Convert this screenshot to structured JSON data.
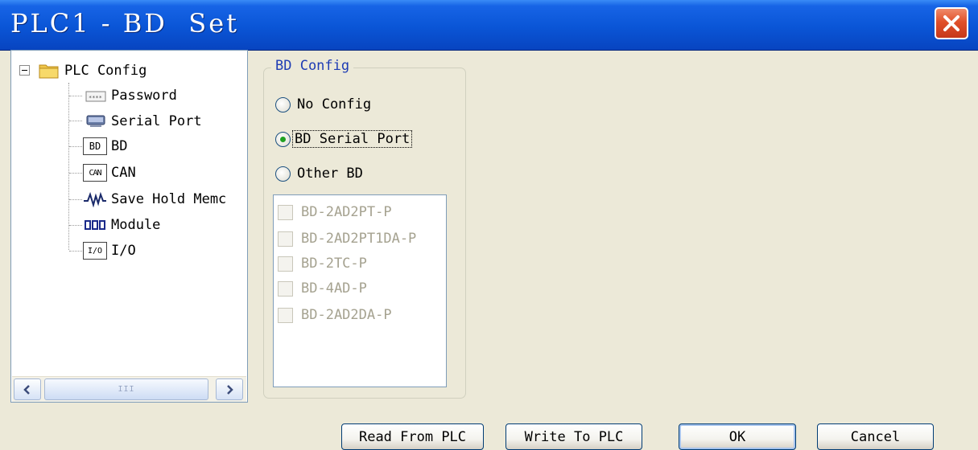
{
  "window": {
    "title": "PLC1 - BD  Set"
  },
  "tree": {
    "root": "PLC Config",
    "items": [
      {
        "label": "Password",
        "icon": "password-icon"
      },
      {
        "label": "Serial Port",
        "icon": "serial-port-icon"
      },
      {
        "label": "BD",
        "icon": "bd-icon",
        "icon_text": "BD",
        "selected": true
      },
      {
        "label": "CAN",
        "icon": "can-icon",
        "icon_text": "CAN"
      },
      {
        "label": "Save Hold Memc",
        "icon": "waveform-icon"
      },
      {
        "label": "Module",
        "icon": "module-icon"
      },
      {
        "label": "I/O",
        "icon": "io-icon",
        "icon_text": "I/O"
      }
    ],
    "scroll_thumb_glyph": "III"
  },
  "bd_config": {
    "legend": "BD Config",
    "options": [
      {
        "label": "No Config",
        "checked": false
      },
      {
        "label": "BD Serial Port",
        "checked": true
      },
      {
        "label": "Other BD",
        "checked": false
      }
    ],
    "modules": [
      {
        "label": "BD-2AD2PT-P",
        "checked": false,
        "enabled": false
      },
      {
        "label": "BD-2AD2PT1DA-P",
        "checked": false,
        "enabled": false
      },
      {
        "label": "BD-2TC-P",
        "checked": false,
        "enabled": false
      },
      {
        "label": "BD-4AD-P",
        "checked": false,
        "enabled": false
      },
      {
        "label": "BD-2AD2DA-P",
        "checked": false,
        "enabled": false
      }
    ]
  },
  "buttons": {
    "read": "Read From PLC",
    "write": "Write To PLC",
    "ok": "OK",
    "cancel": "Cancel"
  },
  "colors": {
    "titlebar": "#0a55d6",
    "close_button": "#e0502a",
    "dialog_background": "#ece9d8",
    "group_legend": "#1e3cb4",
    "disabled_text": "#a5a290"
  }
}
